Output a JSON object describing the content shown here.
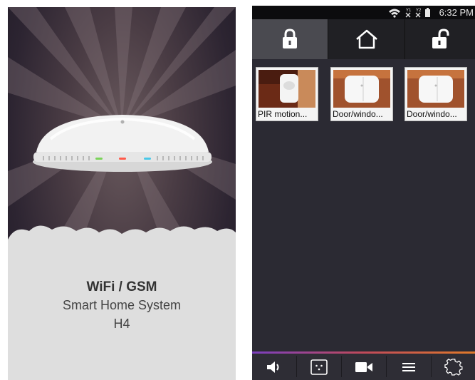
{
  "splash": {
    "title": "WiFi / GSM",
    "subtitle": "Smart Home System",
    "model": "H4"
  },
  "app": {
    "status_bar": {
      "time": "6:32 PM",
      "icons": [
        "wifi-icon",
        "sim1-no-signal-icon",
        "sim2-no-signal-icon",
        "battery-icon"
      ]
    },
    "modes": [
      {
        "name": "arm",
        "icon": "lock-closed-icon",
        "active": true
      },
      {
        "name": "home",
        "icon": "home-icon",
        "active": false
      },
      {
        "name": "disarm",
        "icon": "lock-open-icon",
        "active": false
      }
    ],
    "devices": [
      {
        "label": "PIR motion..."
      },
      {
        "label": "Door/windo..."
      },
      {
        "label": "Door/windo..."
      }
    ],
    "bottom_tabs": [
      {
        "name": "siren",
        "icon": "speaker-icon"
      },
      {
        "name": "remote",
        "icon": "remote-icon"
      },
      {
        "name": "camera",
        "icon": "video-camera-icon"
      },
      {
        "name": "menu",
        "icon": "menu-icon"
      },
      {
        "name": "settings",
        "icon": "gear-icon"
      }
    ],
    "colors": {
      "background": "#2b2a33",
      "mode_bar": "#202024",
      "mode_active": "#4a4a50",
      "accent_start": "#7b3fbf",
      "accent_end": "#e07a2a"
    }
  }
}
